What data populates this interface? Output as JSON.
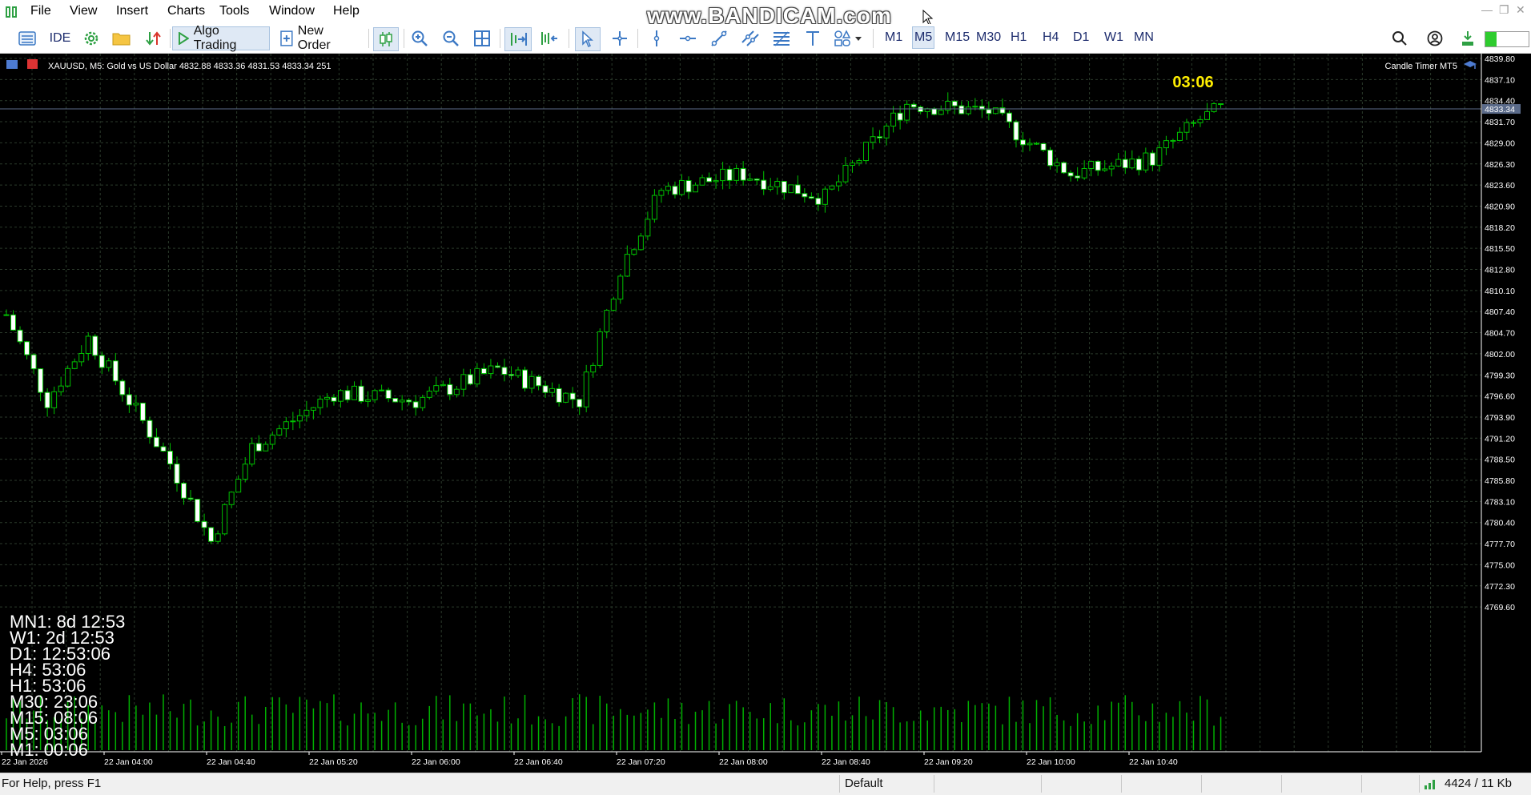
{
  "menu": [
    "File",
    "View",
    "Insert",
    "Charts",
    "Tools",
    "Window",
    "Help"
  ],
  "watermark": "www.BANDICAM.com",
  "toolbar": {
    "ide_label": "IDE",
    "algo_label": "Algo Trading",
    "new_order_label": "New Order"
  },
  "timeframes": [
    "M1",
    "M5",
    "M15",
    "M30",
    "H1",
    "H4",
    "D1",
    "W1",
    "MN"
  ],
  "active_timeframe": "M5",
  "chart": {
    "symbol_info": "XAUUSD, M5:  Gold vs US Dollar  4832.88 4833.36 4831.53 4833.34  251",
    "indicator_name": "Candle Timer MT5",
    "timer": "03:06",
    "current_price": "4833.34",
    "price_labels": [
      "4839.80",
      "4837.10",
      "4834.40",
      "4831.70",
      "4829.00",
      "4826.30",
      "4823.60",
      "4820.90",
      "4818.20",
      "4815.50",
      "4812.80",
      "4810.10",
      "4807.40",
      "4804.70",
      "4802.00",
      "4799.30",
      "4796.60",
      "4793.90",
      "4791.20",
      "4788.50",
      "4785.80",
      "4783.10",
      "4780.40",
      "4777.70",
      "4775.00",
      "4772.30",
      "4769.60"
    ],
    "time_labels": [
      "22 Jan 2026",
      "22 Jan 04:00",
      "22 Jan 04:40",
      "22 Jan 05:20",
      "22 Jan 06:00",
      "22 Jan 06:40",
      "22 Jan 07:20",
      "22 Jan 08:00",
      "22 Jan 08:40",
      "22 Jan 09:20",
      "22 Jan 10:00",
      "22 Jan 10:40"
    ],
    "countdowns": [
      "MN1: 8d 12:53",
      "W1: 2d 12:53",
      "D1: 12:53:06",
      "H4: 53:06",
      "H1: 53:06",
      "M30: 23:06",
      "M15: 08:06",
      "M5: 03:06",
      "M1: 00:06"
    ],
    "colors": {
      "background": "#000000",
      "grid": "#2b3a2b",
      "bull_fill": "#000000",
      "bear_fill": "#ffffff",
      "wick": "#00c000",
      "volume": "#00b000",
      "timer": "#ffee00",
      "text": "#ffffff"
    }
  },
  "statusbar": {
    "help": "For Help, press F1",
    "profile": "Default",
    "traffic": "4424 / 11 Kb"
  }
}
